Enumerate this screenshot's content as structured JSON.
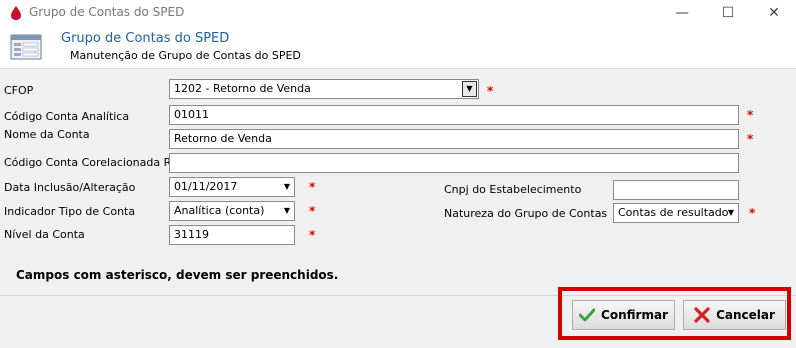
{
  "window": {
    "title": "Grupo de Contas do SPED",
    "minimize_symbol": "—",
    "maximize_symbol": "☐",
    "close_symbol": "✕",
    "app_icon": "blood-drop-icon"
  },
  "header": {
    "icon": "form-window-icon",
    "title": "Grupo de Contas do SPED",
    "subtitle": "Manutenção de Grupo de Contas do SPED"
  },
  "form": {
    "required_mark": "*",
    "cfop": {
      "label": "CFOP",
      "value": "1202  - Retorno de Venda"
    },
    "codigo_conta_analitica": {
      "label": "Código Conta Analítica",
      "value": "01011"
    },
    "nome_da_conta": {
      "label": "Nome da Conta",
      "value": "Retorno de Venda"
    },
    "codigo_conta_corelacionada": {
      "label": "Código Conta Corelacionada RFB",
      "value": ""
    },
    "data_inclusao": {
      "label": "Data Inclusão/Alteração",
      "value": "01/11/2017"
    },
    "indicador_tipo": {
      "label": "Indicador Tipo de Conta",
      "value": "Analítica (conta)"
    },
    "nivel_conta": {
      "label": "Nível da Conta",
      "value": "31119"
    },
    "cnpj": {
      "label": "Cnpj do Estabelecimento",
      "value": ""
    },
    "natureza": {
      "label": "Natureza do Grupo de Contas",
      "value": "Contas de resultado"
    }
  },
  "note": "Campos com asterisco, devem ser preenchidos.",
  "buttons": {
    "confirmar": {
      "label": "Confirmar",
      "icon": "checkmark-icon"
    },
    "cancelar": {
      "label": "Cancelar",
      "icon": "cancel-x-icon"
    }
  },
  "colors": {
    "highlight": "#d20000",
    "header_title": "#1f5fa8",
    "required": "#e00000"
  }
}
